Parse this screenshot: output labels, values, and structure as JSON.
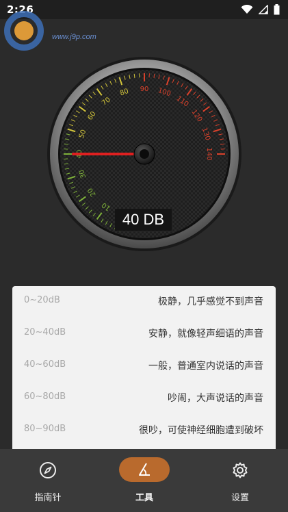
{
  "status_bar": {
    "time": "2:26"
  },
  "watermark": {
    "url": "www.j9p.com"
  },
  "gauge": {
    "reading_label": "40 DB",
    "needle_value": 40,
    "ticks": [
      "0",
      "10",
      "20",
      "30",
      "40",
      "50",
      "60",
      "70",
      "80",
      "90",
      "100",
      "110",
      "120",
      "130",
      "140"
    ]
  },
  "levels": [
    {
      "range": "0~20dB",
      "description": "极静，几乎感觉不到声音"
    },
    {
      "range": "20~40dB",
      "description": "安静，就像轻声细语的声音"
    },
    {
      "range": "40~60dB",
      "description": "一般，普通室内说话的声音"
    },
    {
      "range": "60~80dB",
      "description": "吵闹，大声说话的声音"
    },
    {
      "range": "80~90dB",
      "description": "很吵，可使神经细胞遭到破坏"
    }
  ],
  "tabs": [
    {
      "label": "指南针",
      "icon": "compass-icon"
    },
    {
      "label": "工具",
      "icon": "angle-icon",
      "active": true
    },
    {
      "label": "设置",
      "icon": "gear-icon"
    }
  ],
  "colors": {
    "accent": "#b96a2d",
    "tick_green": "#7fb23a",
    "tick_yellow": "#d2c43a",
    "tick_red": "#d9412b",
    "needle": "#e02020"
  }
}
